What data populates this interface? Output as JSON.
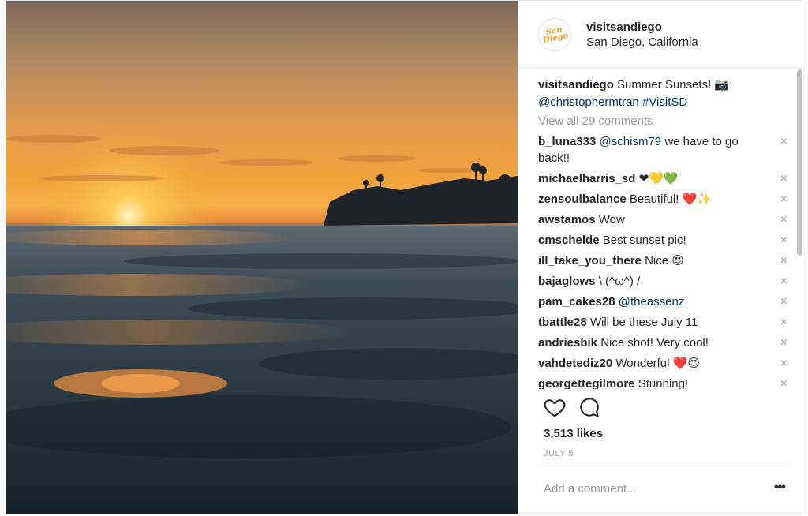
{
  "post": {
    "username": "visitsandiego",
    "location": "San Diego, California",
    "avatar_text": "San Diego",
    "caption": {
      "username": "visitsandiego",
      "text": "Summer Sunsets! 📷:",
      "mention": "@christophermtran",
      "hashtag": "#VisitSD"
    },
    "view_all": "View all 29 comments",
    "comments": [
      {
        "user": "b_luna333",
        "mention": "@schism79",
        "text": "we have to go back!!"
      },
      {
        "user": "michaelharris_sd",
        "mention": "",
        "text": "❤💛💚"
      },
      {
        "user": "zensoulbalance",
        "mention": "",
        "text": "Beautiful! ❤️✨"
      },
      {
        "user": "awstamos",
        "mention": "",
        "text": "Wow"
      },
      {
        "user": "cmschelde",
        "mention": "",
        "text": "Best sunset pic!"
      },
      {
        "user": "ill_take_you_there",
        "mention": "",
        "text": "Nice 😍"
      },
      {
        "user": "bajaglows",
        "mention": "",
        "text": "\\ (^ω^) /"
      },
      {
        "user": "pam_cakes28",
        "mention": "@theassenz",
        "text": ""
      },
      {
        "user": "tbattle28",
        "mention": "",
        "text": "Will be these July 11"
      },
      {
        "user": "andriesbik",
        "mention": "",
        "text": "Nice shot! Very cool!"
      },
      {
        "user": "vahdetediz20",
        "mention": "",
        "text": "Wonderful ❤️😍"
      },
      {
        "user": "georgettegilmore",
        "mention": "",
        "text": "Stunning!"
      }
    ],
    "remove_icon": "×",
    "likes": "3,513 likes",
    "date": "JULY 5",
    "add_comment_placeholder": "Add a comment...",
    "more_icon": "•••"
  },
  "colors": {
    "link": "#003569",
    "muted": "#999999",
    "text": "#262626"
  }
}
